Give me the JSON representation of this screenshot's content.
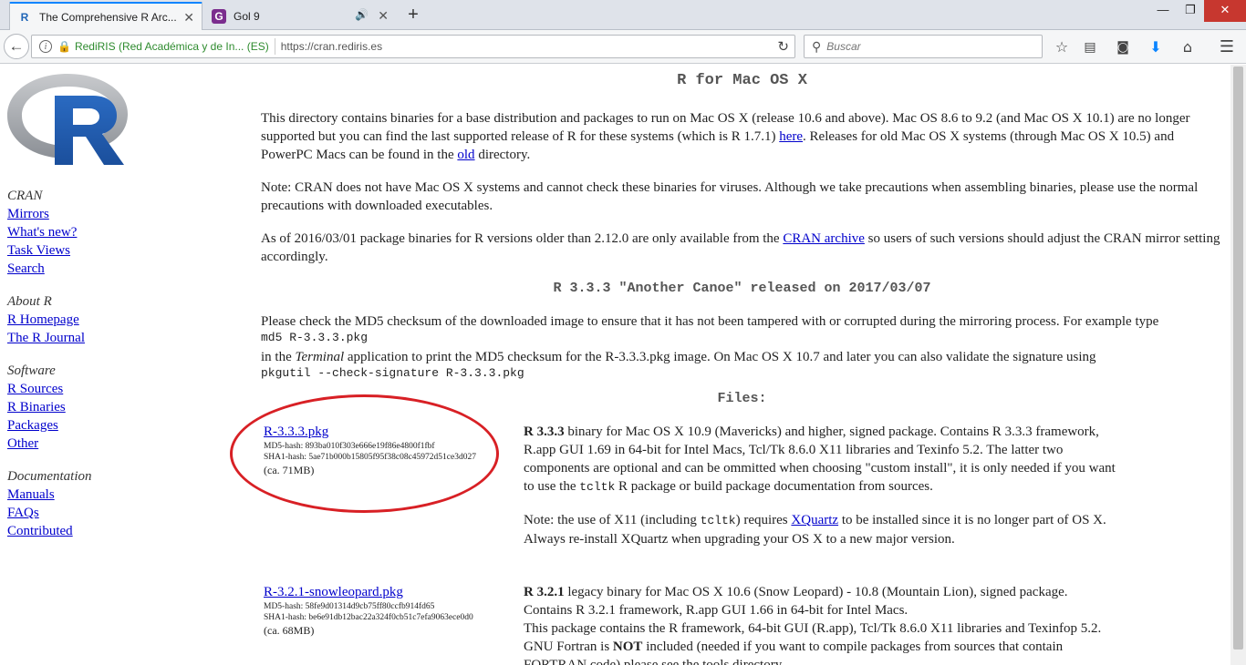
{
  "browser": {
    "tabs": [
      {
        "favicon": "R",
        "title": "The Comprehensive R Arc...",
        "close": "✕"
      },
      {
        "favicon": "G",
        "title": "Gol 9",
        "audio": "🔊",
        "close": "✕"
      }
    ],
    "newtab": "+",
    "window_controls": [
      "—",
      "❐",
      "✕"
    ],
    "identity": "RediRIS (Red Académica y de In...  (ES)",
    "url": "https://cran.rediris.es",
    "search_placeholder": "Buscar",
    "toolbar_icons": [
      "star-icon",
      "reading-list-icon",
      "pocket-icon",
      "download-icon",
      "home-icon",
      "menu-icon"
    ]
  },
  "sidebar": {
    "groups": [
      {
        "heading": "CRAN",
        "links": [
          "Mirrors",
          "What's new?",
          "Task Views",
          "Search"
        ]
      },
      {
        "heading": "About R",
        "links": [
          "R Homepage",
          "The R Journal"
        ]
      },
      {
        "heading": "Software",
        "links": [
          "R Sources",
          "R Binaries",
          "Packages",
          "Other"
        ]
      },
      {
        "heading": "Documentation",
        "links": [
          "Manuals",
          "FAQs",
          "Contributed"
        ]
      }
    ]
  },
  "main": {
    "title": "R for Mac OS X",
    "p1_a": "This directory contains binaries for a base distribution and packages to run on Mac OS X (release 10.6 and above). Mac OS 8.6 to 9.2 (and Mac OS X 10.1) are no longer supported but you can find the last supported release of R for these systems (which is R 1.7.1) ",
    "p1_link1": "here",
    "p1_b": ". Releases for old Mac OS X systems (through Mac OS X 10.5) and PowerPC Macs can be found in the ",
    "p1_link2": "old",
    "p1_c": " directory.",
    "p2": "Note: CRAN does not have Mac OS X systems and cannot check these binaries for viruses. Although we take precautions when assembling binaries, please use the normal precautions with downloaded executables.",
    "p3_a": "As of 2016/03/01 package binaries for R versions older than 2.12.0 are only available from the ",
    "p3_link": "CRAN archive",
    "p3_b": " so users of such versions should adjust the CRAN mirror setting accordingly.",
    "release_heading": "R 3.3.3 \"Another Canoe\" released on 2017/03/07",
    "p4_a": "Please check the MD5 checksum of the downloaded image to ensure that it has not been tampered with or corrupted during the mirroring process. For example type",
    "p4_cmd1": "md5 R-3.3.3.pkg",
    "p4_b1": "in the ",
    "p4_terminal": "Terminal",
    "p4_b2": " application to print the MD5 checksum for the R-3.3.3.pkg image. On Mac OS X 10.7 and later you can also validate the signature using",
    "p4_cmd2": "pkgutil --check-signature R-3.3.3.pkg",
    "files_heading": "Files:",
    "files": [
      {
        "name": "R-3.3.3.pkg",
        "md5": "MD5-hash: 893ba010f303e666e19f86e4800f1fbf",
        "sha1": "SHA1-hash: 5ae71b000b15805f95f38c08c45972d51ce3d027",
        "size": "(ca. 71MB)",
        "desc_bold": "R 3.3.3",
        "desc_a": " binary for Mac OS X 10.9 (Mavericks) and higher, signed package. Contains R 3.3.3 framework, R.app GUI 1.69 in 64-bit for Intel Macs, Tcl/Tk 8.6.0 X11 libraries and Texinfo 5.2. The latter two components are optional and can be ommitted when choosing \"custom install\", it is only needed if you want to use the ",
        "desc_code": "tcltk",
        "desc_b": " R package or build package documentation from sources.",
        "note_a": "Note: the use of X11 (including ",
        "note_code": "tcltk",
        "note_b": ") requires ",
        "note_link": "XQuartz",
        "note_c": " to be installed since it is no longer part of OS X. Always re-install XQuartz when upgrading your OS X to a new major version."
      },
      {
        "name": "R-3.2.1-snowleopard.pkg",
        "md5": "MD5-hash: 58fe9d01314d9cb75ff80ccfb914fd65",
        "sha1": "SHA1-hash: be6e91db12bac22a324f0cb51c7efa9063ece0d0",
        "size": "(ca. 68MB)",
        "desc_bold": "R 3.2.1",
        "desc_a": " legacy binary for Mac OS X 10.6 (Snow Leopard) - 10.8 (Mountain Lion), signed package. Contains R 3.2.1 framework, R.app GUI 1.66 in 64-bit for Intel Macs.",
        "desc_b": "This package contains the R framework, 64-bit GUI (R.app), Tcl/Tk 8.6.0 X11 libraries and Texinfop 5.2. GNU Fortran is ",
        "desc_bold2": "NOT",
        "desc_c": " included (needed if you want to compile packages from sources that contain FORTRAN code) please see the tools directory."
      }
    ]
  }
}
